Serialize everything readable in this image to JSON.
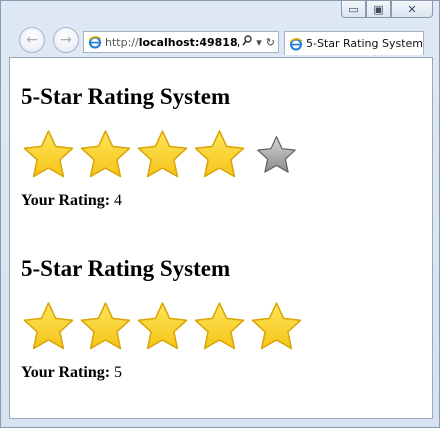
{
  "window": {
    "controls": {
      "minimize": "▭",
      "maximize": "▣",
      "close": "✕"
    }
  },
  "toolbar": {
    "back_icon": "back-arrow-icon",
    "forward_icon": "forward-arrow-icon",
    "address": {
      "scheme": "http://",
      "host": "localhost:49818/"
    },
    "tab_title": "5-Star Rating System"
  },
  "colors": {
    "star_filled": "#f5c518",
    "star_filled_dark": "#d9a406",
    "star_empty": "#8c8c8c",
    "star_empty_dark": "#5e5e5e"
  },
  "widgets": [
    {
      "heading": "5-Star Rating System",
      "rating_label": "Your Rating:",
      "rating": 4,
      "max": 5
    },
    {
      "heading": "5-Star Rating System",
      "rating_label": "Your Rating:",
      "rating": 5,
      "max": 5
    }
  ]
}
